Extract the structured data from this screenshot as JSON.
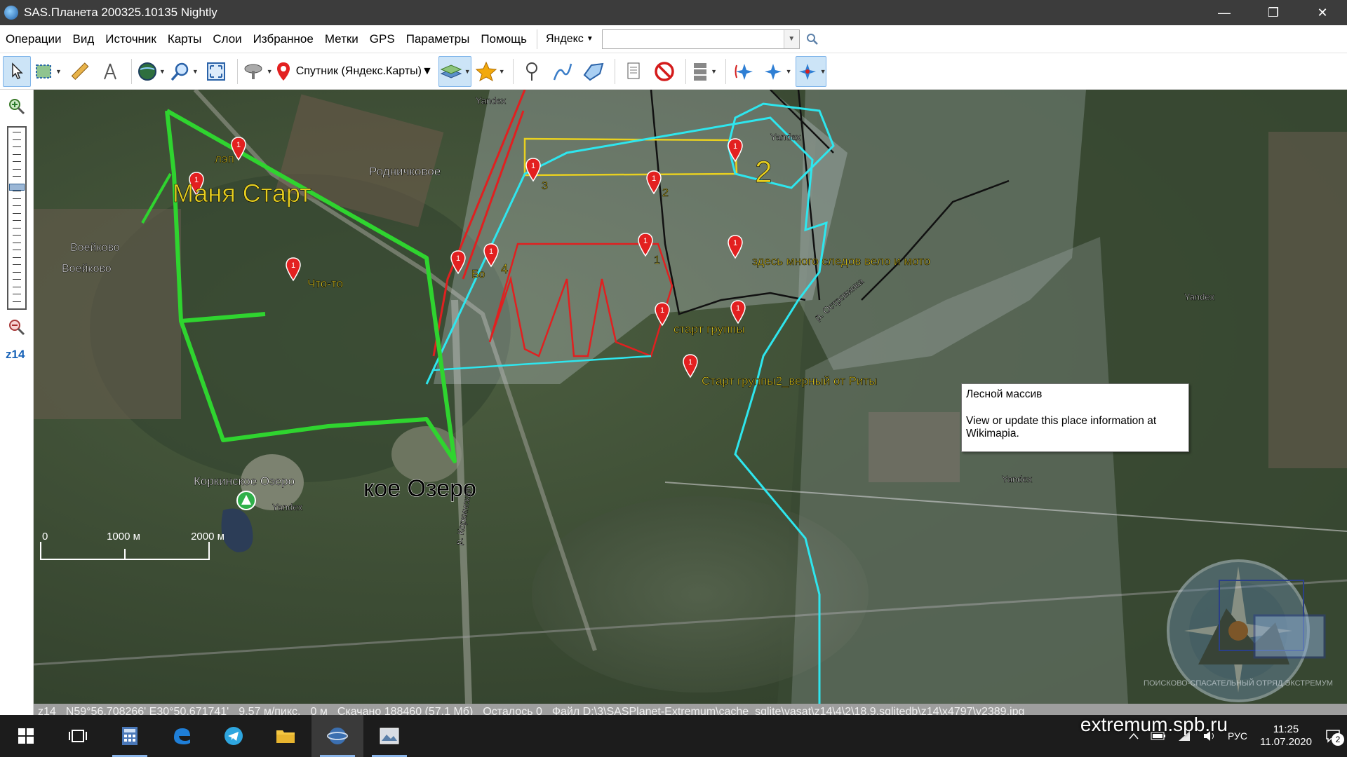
{
  "window": {
    "title": "SAS.Планета 200325.10135 Nightly",
    "controls": {
      "minimize": "—",
      "restore": "❐",
      "close": "✕"
    }
  },
  "menu": {
    "items": [
      "Операции",
      "Вид",
      "Источник",
      "Карты",
      "Слои",
      "Избранное",
      "Метки",
      "GPS",
      "Параметры",
      "Помощь"
    ],
    "search_provider": "Яндекс",
    "search_value": ""
  },
  "toolbar": {
    "map_source": "Спутник (Яндекс.Карты)",
    "icons": [
      "pointer-icon",
      "select-area-icon",
      "ruler-icon",
      "compass-icon",
      "globe-icon",
      "magnifier-icon",
      "fullscreen-icon",
      "satellite-dish-icon",
      "map-pin-icon",
      "layers-icon",
      "star-icon",
      "placemark-icon",
      "path-icon",
      "polygon-icon",
      "note-icon",
      "no-sign-icon",
      "server-icon",
      "gps-icon",
      "gps-track-icon",
      "gps-center-icon"
    ]
  },
  "zoom": {
    "label": "z14",
    "level_fraction": 0.32
  },
  "map": {
    "labels": [
      {
        "text": "Маня Старт",
        "big": true
      },
      {
        "text": "лэп"
      },
      {
        "text": "Что-то"
      },
      {
        "text": "Родничковое"
      },
      {
        "text": "3"
      },
      {
        "text": "2"
      },
      {
        "text": "2"
      },
      {
        "text": "1"
      },
      {
        "text": "4"
      },
      {
        "text": "Бо"
      },
      {
        "text": "здесь много следов вело и мото"
      },
      {
        "text": "старт группы"
      },
      {
        "text": "Старт группы2_верный от Риты"
      },
      {
        "text": "Воейково"
      },
      {
        "text": "Воейково"
      },
      {
        "text": "Коркинское Озеро"
      },
      {
        "text": "кое Озеро"
      },
      {
        "text": "р. Коркинская"
      },
      {
        "text": "р. Островинка"
      },
      {
        "text": "Yandex"
      },
      {
        "text": "Yandex"
      },
      {
        "text": "Yandex"
      },
      {
        "text": "Yandex"
      },
      {
        "text": "Yandex"
      }
    ],
    "scale": {
      "mid": "1000 м",
      "end": "2000 м",
      "zero": "0"
    },
    "tooltip": {
      "title": "Лесной массив",
      "body": "View or update this place information at Wikimapia."
    },
    "watermark": "ПОИСКОВО-СПАСАТЕЛЬНЫЙ ОТРЯД ЭКСТРЕМУМ"
  },
  "status": {
    "zoom": "z14",
    "coords": "N59°56,708266' E30°50,671741'",
    "resolution": "9,57 м/пикс.",
    "distance": "0 м",
    "downloaded": "Скачано 188460 (57,1 Мб)",
    "remaining": "Осталось 0",
    "file": "Файл D:\\3\\SASPlanet-Extremum\\cache_sqlite\\yasat\\z14\\4\\2\\18.9.sqlitedb\\z14\\x4797\\y2389.jpg"
  },
  "taskbar": {
    "tray_text": "extremum.spb.ru",
    "lang": "РУС",
    "time": "11:25",
    "date": "11.07.2020",
    "notifications": "2"
  }
}
